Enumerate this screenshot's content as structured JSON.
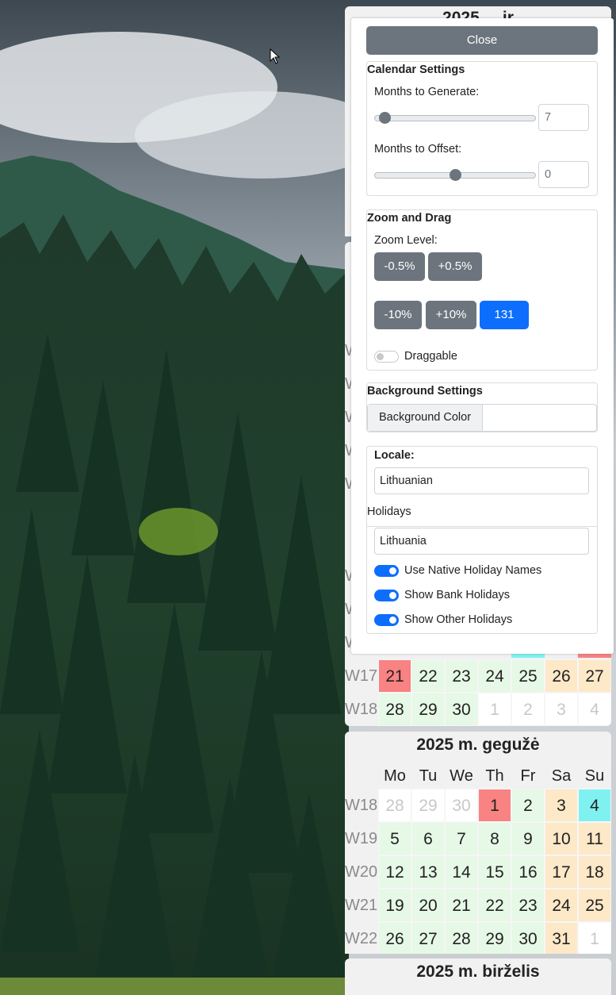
{
  "window": {
    "cursor": "arrow-cursor-icon"
  },
  "colors": {
    "accent": "#0d6efd",
    "secondary": "#6c757d",
    "weekday": "#e6f8e6",
    "weekend": "#fde8c8",
    "holiday": "#f98282",
    "sunday_holiday": "#7ff1f1"
  },
  "panel": {
    "close_label": "Close",
    "calendar_settings": {
      "legend": "Calendar Settings",
      "months_generate_label": "Months to Generate:",
      "months_generate_value": "7",
      "months_generate_fraction": 0.05,
      "months_offset_label": "Months to Offset:",
      "months_offset_value": "0",
      "months_offset_fraction": 0.5
    },
    "zoom": {
      "legend": "Zoom and Drag",
      "zoom_label": "Zoom Level:",
      "minus_small": "-0.5%",
      "plus_small": "+0.5%",
      "minus_large": "-10%",
      "plus_large": "+10%",
      "current": "131",
      "draggable_label": "Draggable",
      "draggable_on": false
    },
    "background": {
      "legend": "Background Settings",
      "color_label": "Background Color",
      "color_value": ""
    },
    "locale": {
      "legend": "Locale:",
      "locale_value": "Lithuanian",
      "holidays_label": "Holidays",
      "holidays_value": "Lithuania",
      "native_names_label": "Use Native Holiday Names",
      "bank_label": "Show Bank Holidays",
      "other_label": "Show Other Holidays"
    }
  },
  "calendars": {
    "top_title": "2025 m. gegužė",
    "april": {
      "weeks": [
        {
          "wk": "W",
          "days": []
        },
        {
          "wk": "W",
          "days": []
        },
        {
          "wk": "W",
          "days": []
        },
        {
          "wk": "W",
          "days": []
        },
        {
          "wk": "W",
          "days": []
        },
        {
          "wk": "W",
          "days": []
        },
        {
          "wk": "W",
          "days": []
        },
        {
          "wk": "W",
          "days": []
        },
        {
          "wk": "W",
          "days": []
        },
        {
          "wk": "W",
          "days": []
        },
        {
          "wk": "W17",
          "days": [
            "21",
            "22",
            "23",
            "24",
            "25",
            "26",
            "27"
          ]
        },
        {
          "wk": "W18",
          "days": [
            "28",
            "29",
            "30",
            "1",
            "2",
            "3",
            "4"
          ]
        }
      ]
    },
    "may": {
      "title": "2025 m. gegužė",
      "day_names": [
        "Mo",
        "Tu",
        "We",
        "Th",
        "Fr",
        "Sa",
        "Su"
      ],
      "weeks": [
        {
          "wk": "W18",
          "days": [
            "28",
            "29",
            "30",
            "1",
            "2",
            "3",
            "4"
          ]
        },
        {
          "wk": "W19",
          "days": [
            "5",
            "6",
            "7",
            "8",
            "9",
            "10",
            "11"
          ]
        },
        {
          "wk": "W20",
          "days": [
            "12",
            "13",
            "14",
            "15",
            "16",
            "17",
            "18"
          ]
        },
        {
          "wk": "W21",
          "days": [
            "19",
            "20",
            "21",
            "22",
            "23",
            "24",
            "25"
          ]
        },
        {
          "wk": "W22",
          "days": [
            "26",
            "27",
            "28",
            "29",
            "30",
            "31",
            "1"
          ]
        }
      ]
    },
    "june": {
      "title": "2025 m. birželis"
    },
    "hidden_title_fragment": "2025 m. ...",
    "partial_title": "2025 ... ir"
  }
}
